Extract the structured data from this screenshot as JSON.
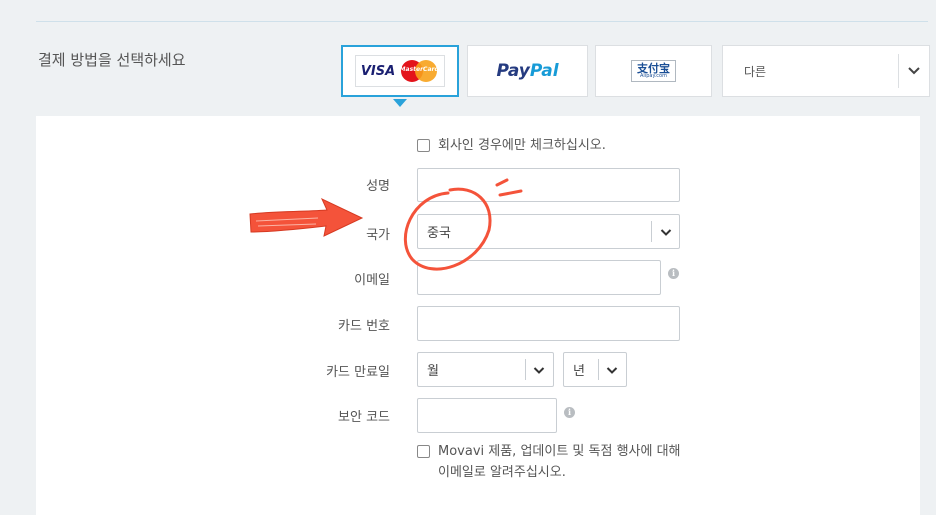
{
  "payment": {
    "label": "결제 방법을 선택하세요",
    "methods": {
      "visa": "VISA",
      "mastercard": "MasterCard",
      "paypal_a": "Pay",
      "paypal_b": "Pal",
      "alipay_cn": "支付宝",
      "alipay_en": "Alipay.com"
    },
    "other_label": "다른"
  },
  "form": {
    "company_checkbox": "회사인 경우에만 체크하십시오.",
    "name_label": "성명",
    "name_value": "",
    "country_label": "국가",
    "country_value": "중국",
    "email_label": "이메일",
    "email_value": "",
    "card_number_label": "카드 번호",
    "card_number_value": "",
    "expiry_label": "카드 만료일",
    "month_value": "월",
    "year_value": "년",
    "security_label": "보안 코드",
    "security_value": "",
    "newsletter_line1": "Movavi 제품, 업데이트 및 독점 행사에 대해",
    "newsletter_line2": "이메일로 알려주십시오."
  },
  "colors": {
    "accent": "#29a2da",
    "annotation": "#f4533a"
  },
  "icons": {
    "info": "info-icon",
    "chevron": "chevron-down-icon",
    "arrow": "arrow-annotation",
    "circle": "circle-annotation"
  }
}
